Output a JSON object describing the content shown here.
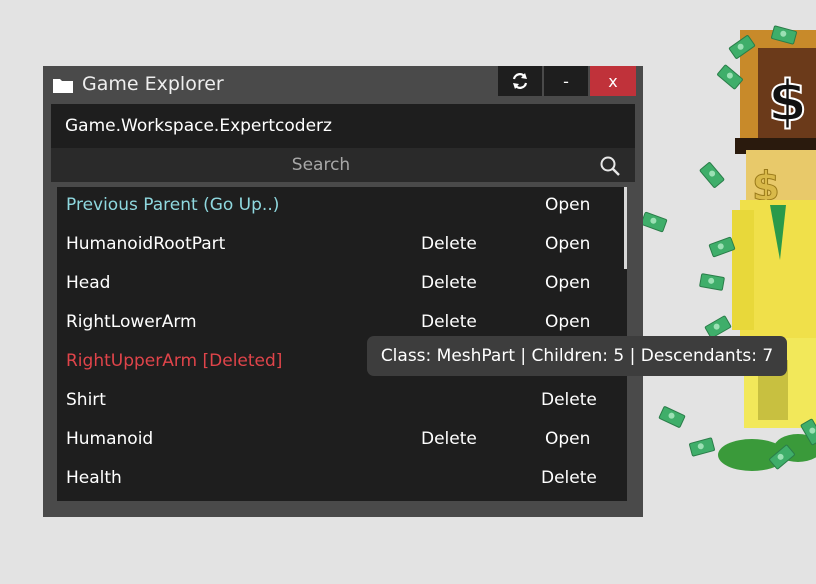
{
  "window": {
    "title": "Game Explorer",
    "refresh_icon": "refresh-icon",
    "minimize_label": "-",
    "close_label": "x"
  },
  "path": "Game.Workspace.Expertcoderz",
  "search": {
    "placeholder": "Search",
    "icon": "search-icon"
  },
  "items": [
    {
      "name": "Previous Parent (Go Up..)",
      "kind": "parent",
      "delete": "",
      "open": "Open"
    },
    {
      "name": "HumanoidRootPart",
      "kind": "normal",
      "delete": "Delete",
      "open": "Open"
    },
    {
      "name": "Head",
      "kind": "normal",
      "delete": "Delete",
      "open": "Open"
    },
    {
      "name": "RightLowerArm",
      "kind": "normal",
      "delete": "Delete",
      "open": "Open"
    },
    {
      "name": "RightUpperArm [Deleted]",
      "kind": "deleted",
      "delete": "",
      "open": ""
    },
    {
      "name": "Shirt",
      "kind": "normal",
      "delete": "Delete",
      "open": ""
    },
    {
      "name": "Humanoid",
      "kind": "normal",
      "delete": "Delete",
      "open": "Open"
    },
    {
      "name": "Health",
      "kind": "normal",
      "delete": "Delete",
      "open": ""
    }
  ],
  "tooltip": "Class: MeshPart | Children: 5 | Descendants: 7",
  "colors": {
    "parent": "#8fd8df",
    "deleted": "#e0444a",
    "close": "#c0323a",
    "panel": "#1e1e1e"
  }
}
